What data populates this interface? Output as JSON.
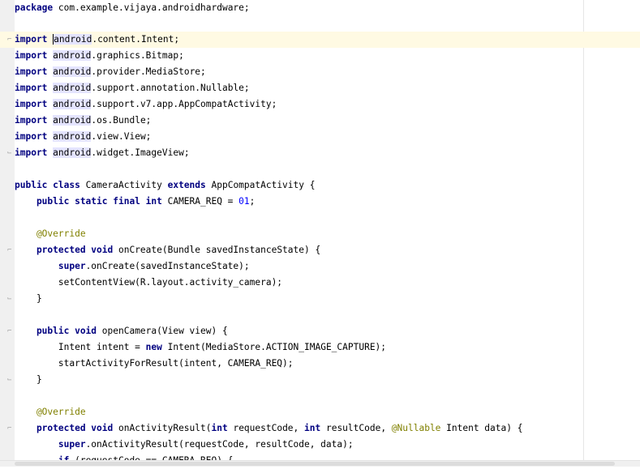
{
  "package_line": {
    "kw": "package",
    "rest": " com.example.vijaya.androidhardware;"
  },
  "imports": [
    {
      "kw": "import",
      "pkg": "android",
      "rest": ".content.Intent;"
    },
    {
      "kw": "import",
      "pkg": "android",
      "rest": ".graphics.Bitmap;"
    },
    {
      "kw": "import",
      "pkg": "android",
      "rest": ".provider.MediaStore;"
    },
    {
      "kw": "import",
      "pkg": "android",
      "rest": ".support.annotation.Nullable;"
    },
    {
      "kw": "import",
      "pkg": "android",
      "rest": ".support.v7.app.AppCompatActivity;"
    },
    {
      "kw": "import",
      "pkg": "android",
      "rest": ".os.Bundle;"
    },
    {
      "kw": "import",
      "pkg": "android",
      "rest": ".view.View;"
    },
    {
      "kw": "import",
      "pkg": "android",
      "rest": ".widget.ImageView;"
    }
  ],
  "class_decl": {
    "kw1": "public class",
    "name": " CameraActivity ",
    "kw2": "extends",
    "rest": " AppCompatActivity {"
  },
  "field": {
    "kw": "    public static final int",
    "rest1": " CAMERA_REQ = ",
    "num": "01",
    "rest2": ";"
  },
  "override1": "    @Override",
  "oncreate_sig": {
    "kw1": "    protected void",
    "rest": " onCreate(Bundle savedInstanceState) {"
  },
  "oncreate_body1": {
    "kw": "        super",
    "rest": ".onCreate(savedInstanceState);"
  },
  "oncreate_body2": "        setContentView(R.layout.activity_camera);",
  "close1": "    }",
  "opencamera_sig": {
    "kw1": "    public void",
    "rest": " openCamera(View view) {"
  },
  "opencamera_body1": {
    "pre": "        Intent intent = ",
    "kw": "new",
    "rest": " Intent(MediaStore.ACTION_IMAGE_CAPTURE);"
  },
  "opencamera_body2": "        startActivityForResult(intent, CAMERA_REQ);",
  "close2": "    }",
  "override2": "    @Override",
  "onactivity_sig": {
    "kw1": "    protected void",
    "rest1": " onActivityResult(",
    "kw2": "int",
    "rest2": " requestCode, ",
    "kw3": "int",
    "rest3": " resultCode, ",
    "ann": "@Nullable",
    "rest4": " Intent data) {"
  },
  "onactivity_body1": {
    "kw": "        super",
    "rest": ".onActivityResult(requestCode, resultCode, data);"
  },
  "onactivity_body2": {
    "kw": "        if",
    "rest": " (requestCode == CAMERA_REQ) {"
  }
}
